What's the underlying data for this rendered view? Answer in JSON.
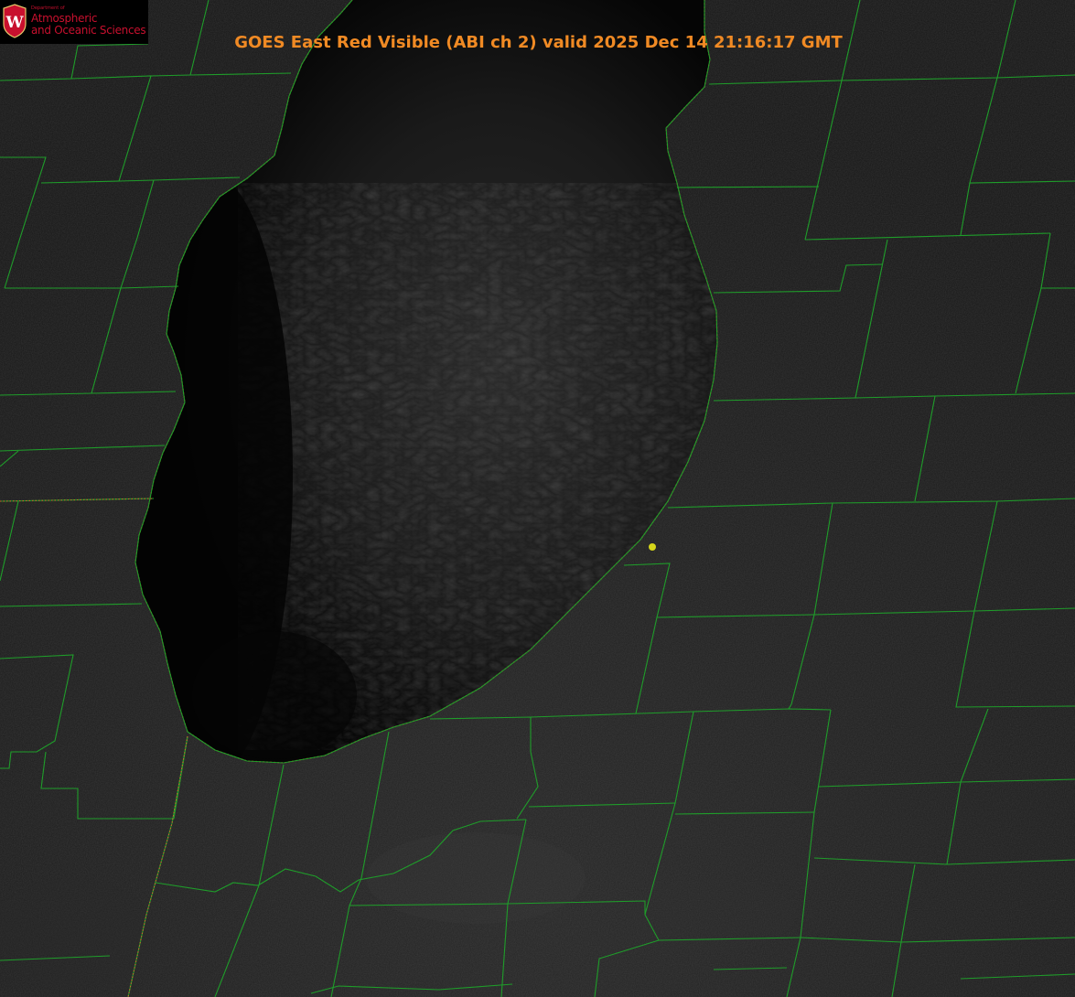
{
  "title": "GOES East Red Visible (ABI ch 2) valid 2025 Dec 14 21:16:17 GMT",
  "logo": {
    "dept": "Department of",
    "line1": "Atmospheric",
    "line2": "and Oceanic Sciences",
    "crest_letter": "W"
  },
  "colors": {
    "county_lines": "#1f9d2a",
    "coastline": "#d22a2a",
    "title": "#f08a24",
    "logo_text": "#c8102e",
    "crest": "#c8102e",
    "marker": "#d6d61a",
    "land": "#1b1b1b",
    "lake": "#0a0a0a"
  },
  "marker_icon": "yellow-dot-marker",
  "legend": []
}
